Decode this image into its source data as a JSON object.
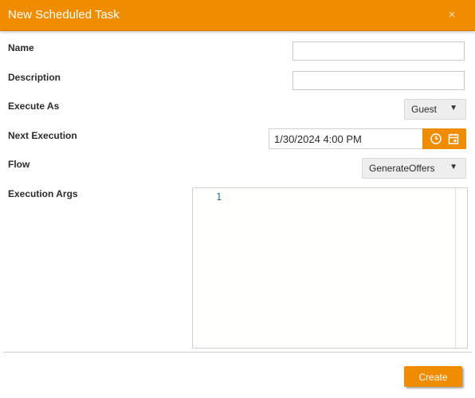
{
  "dialog": {
    "title": "New Scheduled Task",
    "close_symbol": "×"
  },
  "fields": {
    "name": {
      "label": "Name",
      "value": ""
    },
    "description": {
      "label": "Description",
      "value": ""
    },
    "execute_as": {
      "label": "Execute As",
      "selected": "Guest"
    },
    "next_execution": {
      "label": "Next Execution",
      "value": "1/30/2024 4:00 PM"
    },
    "flow": {
      "label": "Flow",
      "selected": "GenerateOffers"
    },
    "execution_args": {
      "label": "Execution Args",
      "line_numbers": [
        "1"
      ]
    }
  },
  "footer": {
    "create_label": "Create"
  },
  "icons": {
    "close": "close-icon",
    "clock": "clock-icon",
    "calendar": "calendar-icon",
    "dropdown_arrow": "chevron-down-icon"
  },
  "colors": {
    "accent": "#ef8c00",
    "title_text": "#ffffff"
  }
}
